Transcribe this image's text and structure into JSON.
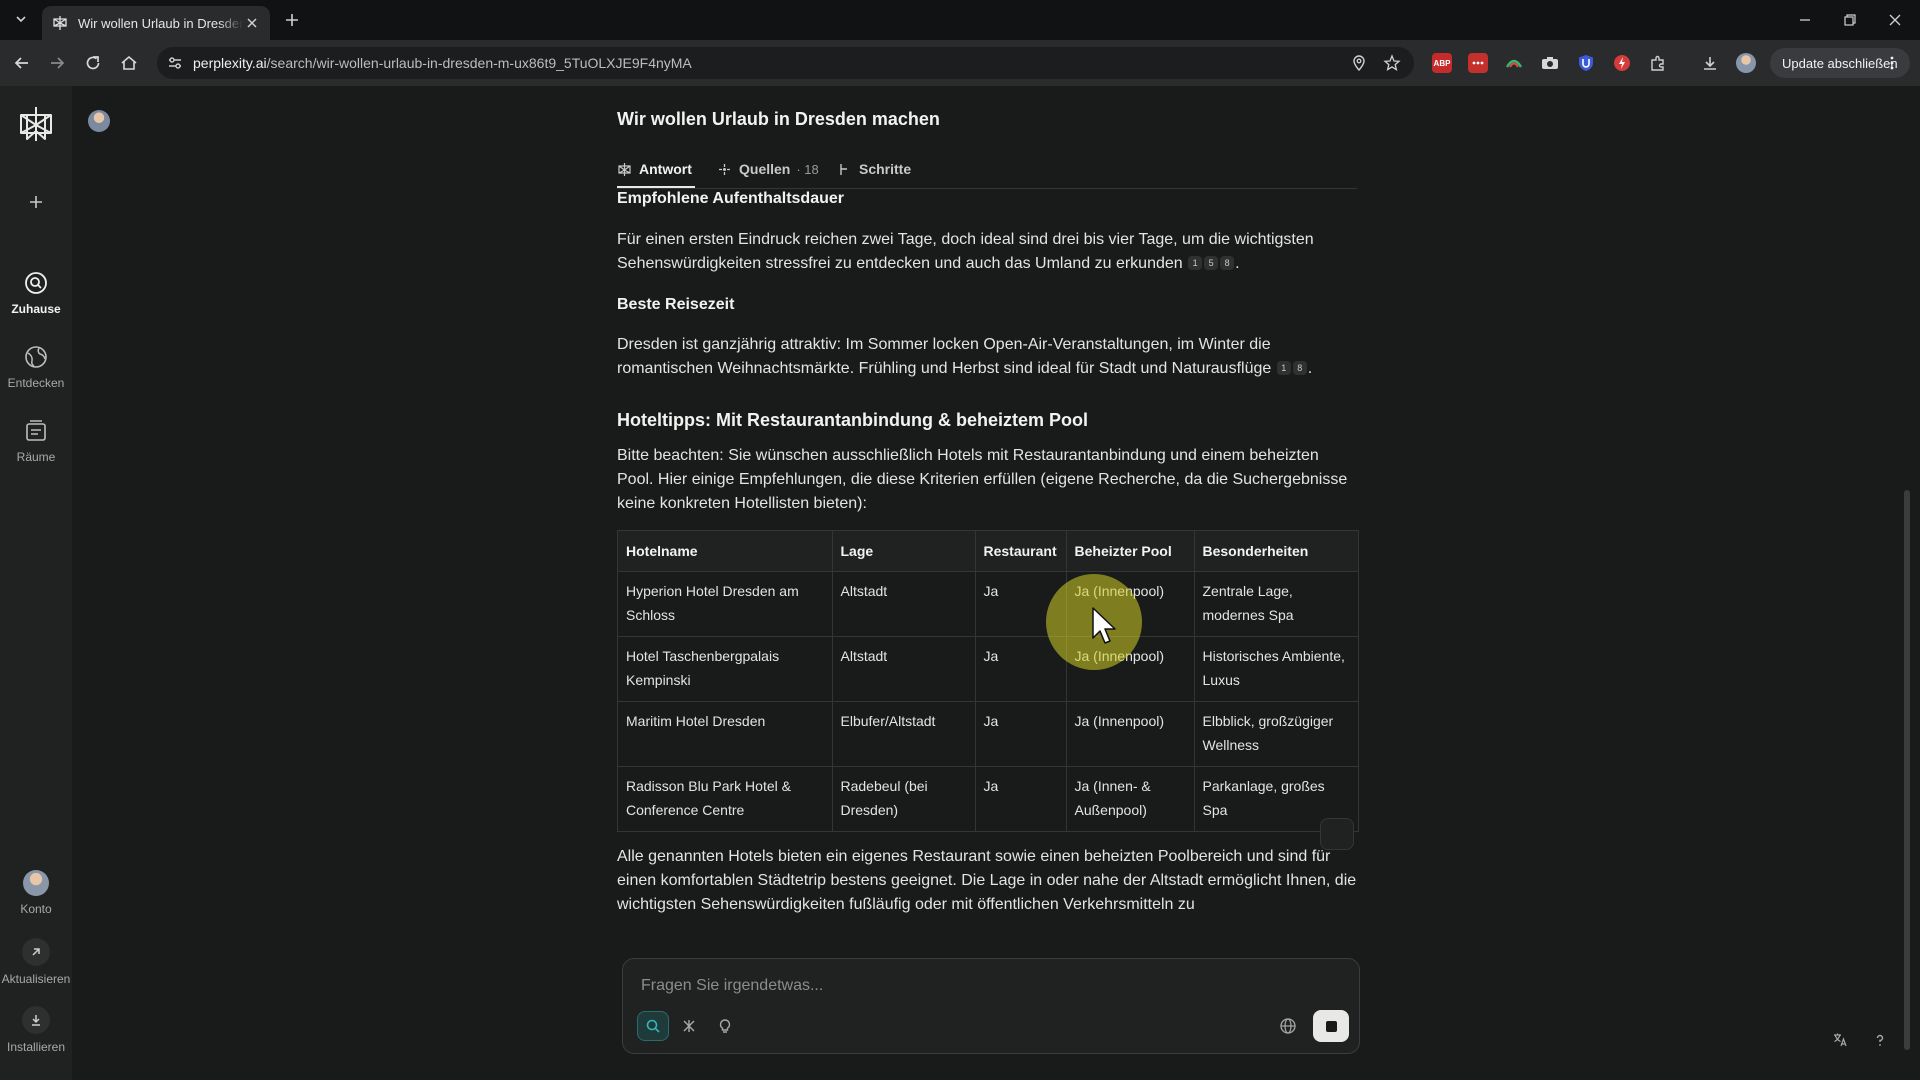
{
  "browser": {
    "tab_title": "Wir wollen Urlaub in Dresden machen",
    "url_host": "perplexity.ai",
    "url_path": "/search/wir-wollen-urlaub-in-dresden-m-ux86t9_5TuOLXJE9F4nyMA",
    "update_label": "Update abschließen",
    "extension_abp": "ABP"
  },
  "sidebar": {
    "items": [
      {
        "label": "Zuhause"
      },
      {
        "label": "Entdecken"
      },
      {
        "label": "Räume"
      }
    ],
    "bottom": [
      {
        "label": "Konto"
      },
      {
        "label": "Aktualisieren"
      },
      {
        "label": "Installieren"
      }
    ]
  },
  "thread": {
    "title": "Wir wollen Urlaub in Dresden machen",
    "tabs": {
      "answer": "Antwort",
      "sources": "Quellen",
      "sources_count": "· 18",
      "steps": "Schritte"
    }
  },
  "answer": {
    "s1_heading": "Empfohlene Aufenthaltsdauer",
    "s1_text": "Für einen ersten Eindruck reichen zwei Tage, doch ideal sind drei bis vier Tage, um die wichtigsten Sehenswürdigkeiten stressfrei zu entdecken und auch das Umland zu erkunden",
    "s1_cites": [
      "1",
      "5",
      "8"
    ],
    "s2_heading": "Beste Reisezeit",
    "s2_text": "Dresden ist ganzjährig attraktiv: Im Sommer locken Open-Air-Veranstaltungen, im Winter die romantischen Weihnachtsmärkte. Frühling und Herbst sind ideal für Stadt und Naturausflüge",
    "s2_cites": [
      "1",
      "8"
    ],
    "s3_heading": "Hoteltipps: Mit Restaurantanbindung & beheiztem Pool",
    "s3_text": "Bitte beachten: Sie wünschen ausschließlich Hotels mit Restaurantanbindung und einem beheizten Pool. Hier einige Empfehlungen, die diese Kriterien erfüllen (eigene Recherche, da die Suchergebnisse keine konkreten Hotellisten bieten):",
    "table": {
      "headers": [
        "Hotelname",
        "Lage",
        "Restaurant",
        "Beheizter Pool",
        "Besonderheiten"
      ],
      "rows": [
        [
          "Hyperion Hotel Dresden am Schloss",
          "Altstadt",
          "Ja",
          "Ja (Innenpool)",
          "Zentrale Lage, modernes Spa"
        ],
        [
          "Hotel Taschenbergpalais Kempinski",
          "Altstadt",
          "Ja",
          "Ja (Innenpool)",
          "Historisches Ambiente, Luxus"
        ],
        [
          "Maritim Hotel Dresden",
          "Elbufer/Altstadt",
          "Ja",
          "Ja (Innenpool)",
          "Elbblick, großzügiger Wellness"
        ],
        [
          "Radisson Blu Park Hotel & Conference Centre",
          "Radebeul (bei Dresden)",
          "Ja",
          "Ja (Innen- & Außenpool)",
          "Parkanlage, großes Spa"
        ]
      ]
    },
    "s4_text": "Alle genannten Hotels bieten ein eigenes Restaurant sowie einen beheizten Poolbereich und sind für einen komfortablen Städtetrip bestens geeignet. Die Lage in oder nahe der Altstadt ermöglicht Ihnen, die wichtigsten Sehenswürdigkeiten fußläufig oder mit öffentlichen Verkehrsmitteln zu"
  },
  "ask": {
    "placeholder": "Fragen Sie irgendetwas..."
  },
  "colors": {
    "background": "#191a1a",
    "sidebar": "#202222",
    "accent": "#34b6b6",
    "cursor_highlight": "#d2d228"
  }
}
